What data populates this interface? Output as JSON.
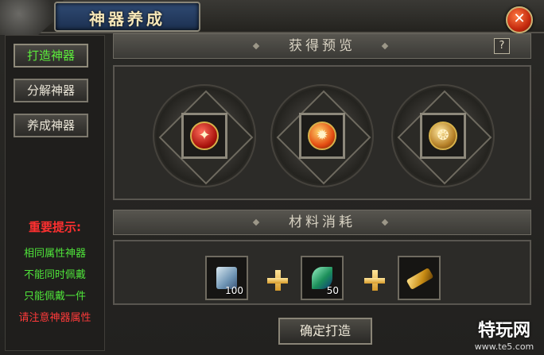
{
  "window": {
    "title": "神器养成"
  },
  "sidebar": {
    "items": [
      {
        "label": "打造神器",
        "active": true
      },
      {
        "label": "分解神器",
        "active": false
      },
      {
        "label": "养成神器",
        "active": false
      }
    ],
    "hint_title": "重要提示:",
    "hints": [
      {
        "text": "相同属性神器",
        "color": "green"
      },
      {
        "text": "不能同时佩戴",
        "color": "green"
      },
      {
        "text": "只能佩戴一件",
        "color": "green"
      },
      {
        "text": "请注意神器属性",
        "color": "red"
      }
    ]
  },
  "preview": {
    "header": "获得预览",
    "help_label": "?",
    "items": [
      {
        "icon": "red-gem-icon",
        "glyph": "✦"
      },
      {
        "icon": "fire-gem-icon",
        "glyph": "✹"
      },
      {
        "icon": "gold-gem-icon",
        "glyph": "❂"
      }
    ]
  },
  "materials": {
    "header": "材料消耗",
    "items": [
      {
        "icon": "blue-stone-icon",
        "count": "100"
      },
      {
        "icon": "green-crystal-icon",
        "count": "50"
      },
      {
        "icon": "gold-bar-icon",
        "count": ""
      }
    ]
  },
  "actions": {
    "confirm_label": "确定打造"
  },
  "watermark": {
    "logo": "特玩网",
    "url": "www.te5.com"
  },
  "colors": {
    "active_green": "#5bea3b",
    "hint_red": "#ff3030",
    "title_blue": "#2f4a73"
  }
}
